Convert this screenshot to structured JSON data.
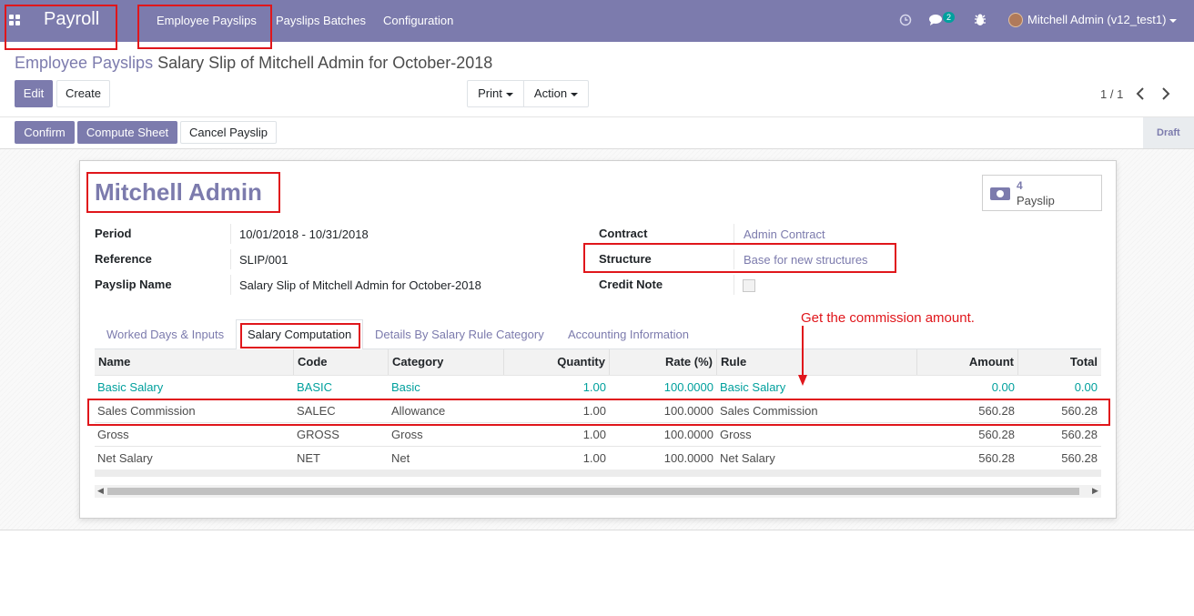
{
  "navbar": {
    "brand": "Payroll",
    "menu": [
      "Employee Payslips",
      "Payslips Batches",
      "Configuration"
    ],
    "chat_badge": "2",
    "user": "Mitchell Admin (v12_test1)"
  },
  "breadcrumb": {
    "parent": "Employee Payslips",
    "current": "Salary Slip of Mitchell Admin for October-2018"
  },
  "buttons": {
    "edit": "Edit",
    "create": "Create",
    "print": "Print",
    "action": "Action"
  },
  "pager": {
    "value": "1 / 1"
  },
  "status_buttons": {
    "confirm": "Confirm",
    "compute": "Compute Sheet",
    "cancel": "Cancel Payslip"
  },
  "status": "Draft",
  "employee": "Mitchell Admin",
  "smart_button": {
    "count": "4",
    "label": "Payslip"
  },
  "fields": {
    "period_label": "Period",
    "period": "10/01/2018 - 10/31/2018",
    "reference_label": "Reference",
    "reference": "SLIP/001",
    "payslip_name_label": "Payslip Name",
    "payslip_name": "Salary Slip of Mitchell Admin for October-2018",
    "contract_label": "Contract",
    "contract": "Admin Contract",
    "structure_label": "Structure",
    "structure": "Base for new structures",
    "credit_note_label": "Credit Note"
  },
  "tabs": [
    "Worked Days & Inputs",
    "Salary Computation",
    "Details By Salary Rule Category",
    "Accounting Information"
  ],
  "annotation": "Get the commission amount.",
  "table": {
    "headers": [
      "Name",
      "Code",
      "Category",
      "Quantity",
      "Rate (%)",
      "Rule",
      "Amount",
      "Total"
    ],
    "rows": [
      [
        "Basic Salary",
        "BASIC",
        "Basic",
        "1.00",
        "100.0000",
        "Basic Salary",
        "0.00",
        "0.00"
      ],
      [
        "Sales Commission",
        "SALEC",
        "Allowance",
        "1.00",
        "100.0000",
        "Sales Commission",
        "560.28",
        "560.28"
      ],
      [
        "Gross",
        "GROSS",
        "Gross",
        "1.00",
        "100.0000",
        "Gross",
        "560.28",
        "560.28"
      ],
      [
        "Net Salary",
        "NET",
        "Net",
        "1.00",
        "100.0000",
        "Net Salary",
        "560.28",
        "560.28"
      ]
    ]
  },
  "colors": {
    "brand": "#7c7bad",
    "link_teal": "#00a09d",
    "annotation_red": "#e0161b"
  }
}
